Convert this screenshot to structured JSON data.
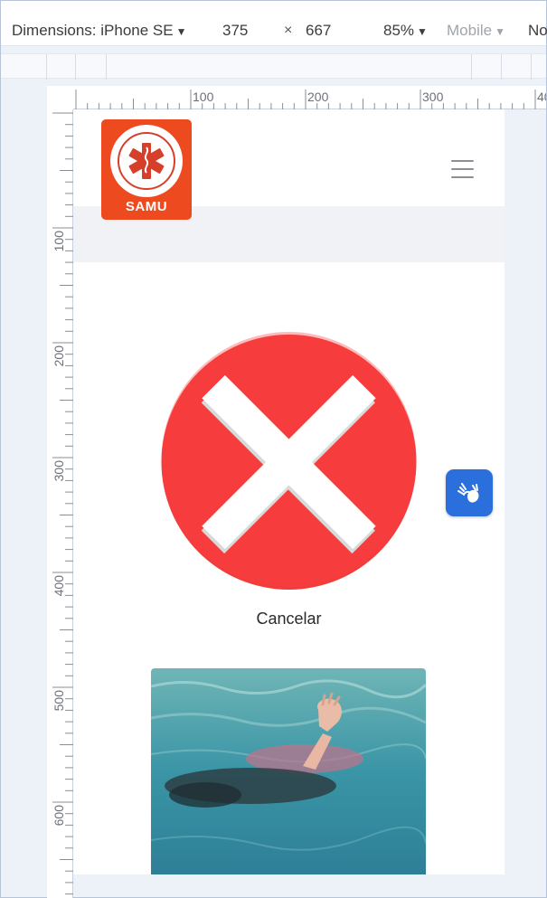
{
  "toolbar": {
    "dimensions_label": "Dimensions: iPhone SE",
    "width": "375",
    "times": "×",
    "height": "667",
    "zoom": "85%",
    "mode": "Mobile",
    "overflow": "No",
    "caret": "▼"
  },
  "ruler": {
    "horizontal_labels": [
      "100",
      "200",
      "300",
      "40"
    ],
    "vertical_labels": [
      "100",
      "200",
      "300",
      "400",
      "500",
      "600"
    ]
  },
  "page": {
    "logo_text": "SAMU",
    "cancel_label": "Cancelar"
  },
  "icons": {
    "menu": "hamburger-menu-icon",
    "cancel": "cancel-x-icon",
    "accessibility": "sign-language-hands-icon"
  },
  "colors": {
    "logo_bg": "#ee4a1f",
    "cancel_red": "#f23c3c",
    "a11y_blue": "#2b6fdc",
    "gray_band": "#f0f2f5"
  }
}
